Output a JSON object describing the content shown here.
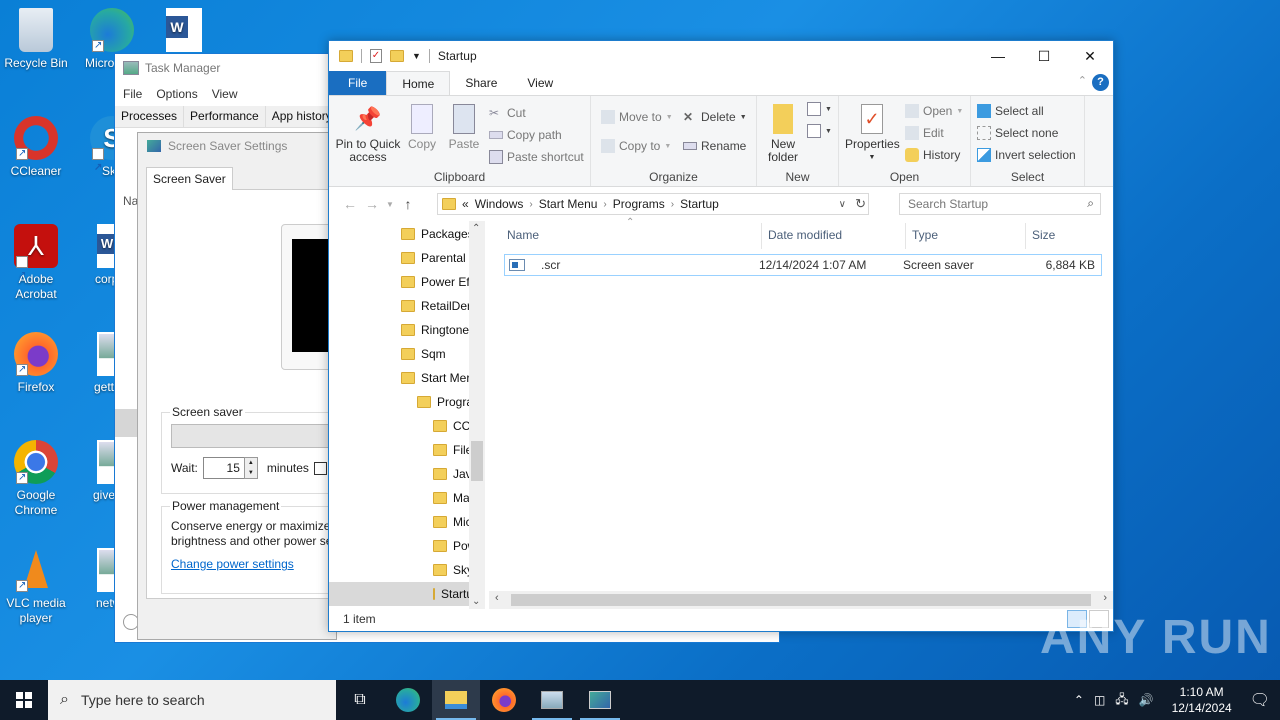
{
  "desktop": {
    "icons": [
      {
        "label": "Recycle Bin"
      },
      {
        "label": "Microsoft Edge"
      },
      {
        "label": "Word document"
      },
      {
        "label": "CCleaner"
      },
      {
        "label": "Skype"
      },
      {
        "label": "Adobe Acrobat"
      },
      {
        "label": "corpor"
      },
      {
        "label": "Firefox"
      },
      {
        "label": "getting"
      },
      {
        "label": "Google Chrome"
      },
      {
        "label": "giveblac"
      },
      {
        "label": "VLC media player"
      },
      {
        "label": "netwo"
      }
    ],
    "col2_labels": [
      "Micro Edg",
      "Sky",
      "corpor",
      "getting",
      "givebla",
      "netwo"
    ]
  },
  "task_manager": {
    "title": "Task Manager",
    "menu": [
      "File",
      "Options",
      "View"
    ],
    "tabs": [
      "Processes",
      "Performance",
      "App history"
    ],
    "column_fragment": "Na"
  },
  "screen_saver": {
    "title": "Screen Saver Settings",
    "tab": "Screen Saver",
    "group_screen_saver": "Screen saver",
    "selected_saver": "",
    "wait_label": "Wait:",
    "wait_value": "15",
    "minutes_label": "minutes",
    "group_power": "Power management",
    "power_text_1": "Conserve energy or maximize",
    "power_text_2": "brightness and other power se",
    "power_link": "Change power settings"
  },
  "explorer": {
    "title": "Startup",
    "window_controls": {
      "minimize": "—",
      "maximize": "☐",
      "close": "✕"
    },
    "ribbon_tabs": [
      "File",
      "Home",
      "Share",
      "View"
    ],
    "active_tab": "Home",
    "ribbon": {
      "clipboard": {
        "label": "Clipboard",
        "pin": "Pin to Quick access",
        "pin_l1": "Pin to Quick",
        "pin_l2": "access",
        "copy": "Copy",
        "paste": "Paste",
        "cut": "Cut",
        "copy_path": "Copy path",
        "paste_shortcut": "Paste shortcut"
      },
      "organize": {
        "label": "Organize",
        "move_to": "Move to",
        "copy_to": "Copy to",
        "delete": "Delete",
        "rename": "Rename"
      },
      "new": {
        "label": "New",
        "new_folder_l1": "New",
        "new_folder_l2": "folder"
      },
      "open": {
        "label": "Open",
        "properties": "Properties",
        "open": "Open",
        "edit": "Edit",
        "history": "History"
      },
      "select": {
        "label": "Select",
        "select_all": "Select all",
        "select_none": "Select none",
        "invert": "Invert selection"
      }
    },
    "address": {
      "prefix": "«",
      "crumbs": [
        "Windows",
        "Start Menu",
        "Programs",
        "Startup"
      ]
    },
    "search_placeholder": "Search Startup",
    "nav_tree": [
      {
        "label": "Packages",
        "level": 0
      },
      {
        "label": "Parental",
        "level": 0
      },
      {
        "label": "Power Ef",
        "level": 0
      },
      {
        "label": "RetailDer",
        "level": 0
      },
      {
        "label": "Ringtone",
        "level": 0
      },
      {
        "label": "Sqm",
        "level": 0
      },
      {
        "label": "Start Mer",
        "level": 0
      },
      {
        "label": "Prograr",
        "level": 1
      },
      {
        "label": "CClea",
        "level": 2
      },
      {
        "label": "FileZil",
        "level": 2
      },
      {
        "label": "Java",
        "level": 2
      },
      {
        "label": "Maint",
        "level": 2
      },
      {
        "label": "Micro",
        "level": 2
      },
      {
        "label": "Powe",
        "level": 2
      },
      {
        "label": "Skype",
        "level": 2
      },
      {
        "label": "Startu",
        "level": 2,
        "selected": true
      }
    ],
    "columns": [
      "Name",
      "Date modified",
      "Type",
      "Size"
    ],
    "files": [
      {
        "name": ".scr",
        "date": "12/14/2024 1:07 AM",
        "type": "Screen saver",
        "size": "6,884 KB"
      }
    ],
    "status": "1 item"
  },
  "taskbar": {
    "search_placeholder": "Type here to search",
    "apps": [
      "Task View",
      "Microsoft Edge",
      "File Explorer",
      "Firefox",
      "Task Manager",
      "Screen Saver Settings"
    ],
    "time": "1:10 AM",
    "date": "12/14/2024"
  },
  "watermark": "ANY RUN"
}
